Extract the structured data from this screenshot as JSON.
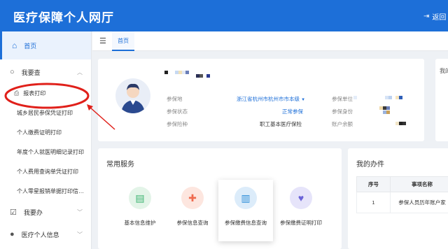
{
  "header": {
    "title": "医疗保障个人网厅",
    "back_label": "返回"
  },
  "sidebar": {
    "home": "首页",
    "groups": [
      {
        "label": "我要查",
        "items": [
          "报表打印",
          "城乡居民参保凭证打印",
          "个人缴费证明打印",
          "年度个人就医明细记录打印",
          "个人费用查询单凭证打印",
          "个人零星报销单据打印信…"
        ]
      },
      {
        "label": "我要办"
      },
      {
        "label": "医疗个人信息"
      }
    ]
  },
  "tabs": {
    "active": "首页"
  },
  "profile": {
    "fields": [
      {
        "label": "参保地",
        "value": "浙江省杭州市杭州市市本级"
      },
      {
        "label": "参保状态",
        "value": "正常参保"
      },
      {
        "label": "参保险种",
        "value": "职工基本医疗保险"
      }
    ],
    "right_fields": [
      "参保单位",
      "参保身份",
      "账户余额"
    ]
  },
  "right_card": {
    "label": "我的"
  },
  "services": {
    "title": "常用服务",
    "items": [
      {
        "label": "基本信息维护",
        "icon": "id-card-icon",
        "color": "#3cb371"
      },
      {
        "label": "参保信息查询",
        "icon": "medkit-icon",
        "color": "#ef6b4f"
      },
      {
        "label": "参保缴费信息查询",
        "icon": "building-icon",
        "color": "#2f8fd8"
      },
      {
        "label": "参保缴费证明打印",
        "icon": "heart-icon",
        "color": "#6a63d8"
      }
    ]
  },
  "todo": {
    "title": "我的办件",
    "columns": [
      "序号",
      "事项名称"
    ],
    "rows": [
      [
        "1",
        "参保人员历年账户家"
      ]
    ]
  },
  "colors": {
    "primary": "#1d6fd8",
    "annotation": "#e0201a"
  }
}
